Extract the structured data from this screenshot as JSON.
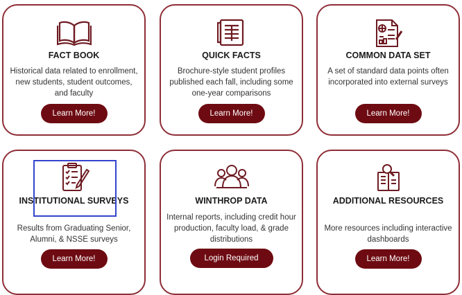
{
  "cards": [
    {
      "icon": "book-icon",
      "title": "FACT BOOK",
      "description": "Historical data related to enrollment, new students, student outcomes, and faculty",
      "button": "Learn More!"
    },
    {
      "icon": "document-list-icon",
      "title": "QUICK FACTS",
      "description": "Brochure-style student profiles published each fall, including some one-year comparisons",
      "button": "Learn More!"
    },
    {
      "icon": "calculator-document-icon",
      "title": "COMMON DATA SET",
      "description": "A set of standard data points often incorporated into external surveys",
      "button": "Learn More!"
    },
    {
      "icon": "checklist-pencil-icon",
      "title": "INSTITUTIONAL SURVEYS",
      "description": "Results from Graduating Senior, Alumni, & NSSE surveys",
      "button": "Learn More!"
    },
    {
      "icon": "people-group-icon",
      "title": "WINTHROP DATA",
      "description": "Internal reports, including credit hour production, faculty load, & grade distributions",
      "button": "Login Required"
    },
    {
      "icon": "search-book-icon",
      "title": "ADDITIONAL RESOURCES",
      "description": "More resources including interactive dashboards",
      "button": "Learn More!"
    }
  ],
  "colors": {
    "accent": "#6e0b12",
    "border": "#8e2d36",
    "highlight": "#ffff33",
    "selection_box": "#3344cc"
  }
}
